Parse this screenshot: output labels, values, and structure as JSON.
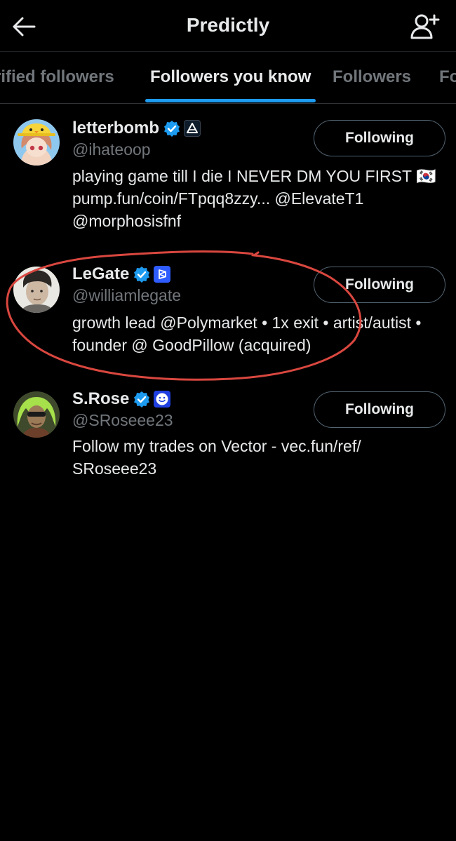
{
  "header": {
    "title": "Predictly",
    "back_icon": "arrow-left-icon",
    "add_icon": "add-user-icon"
  },
  "tabs": [
    {
      "label": "Verified followers",
      "visible_text": "rified followers",
      "active": false
    },
    {
      "label": "Followers you know",
      "active": true
    },
    {
      "label": "Followers",
      "active": false
    },
    {
      "label": "Following",
      "visible_text": "Fo",
      "active": false
    }
  ],
  "accent_color": "#1d9bf0",
  "annotation_color": "#d9473f",
  "users": [
    {
      "name": "letterbomb",
      "handle": "@ihateoop",
      "bio": "playing game till I die I NEVER DM YOU FIRST 🇰🇷 pump.fun/coin/FTpqq8zzy... @ElevateT1 @morphosisfnf",
      "button": "Following",
      "verified": true,
      "affiliate_icon": "triangle-logo-icon"
    },
    {
      "name": "LeGate",
      "handle": "@williamlegate",
      "bio": "growth lead @Polymarket • 1x exit • artist/autist • founder @ GoodPillow (acquired)",
      "button": "Following",
      "verified": true,
      "affiliate_icon": "polymarket-logo-icon",
      "circled": true
    },
    {
      "name": "S.Rose",
      "handle": "@SRoseee23",
      "bio": "Follow my trades on Vector - vec.fun/ref/ SRoseee23",
      "button": "Following",
      "verified": true,
      "affiliate_icon": "smiley-logo-icon"
    }
  ]
}
